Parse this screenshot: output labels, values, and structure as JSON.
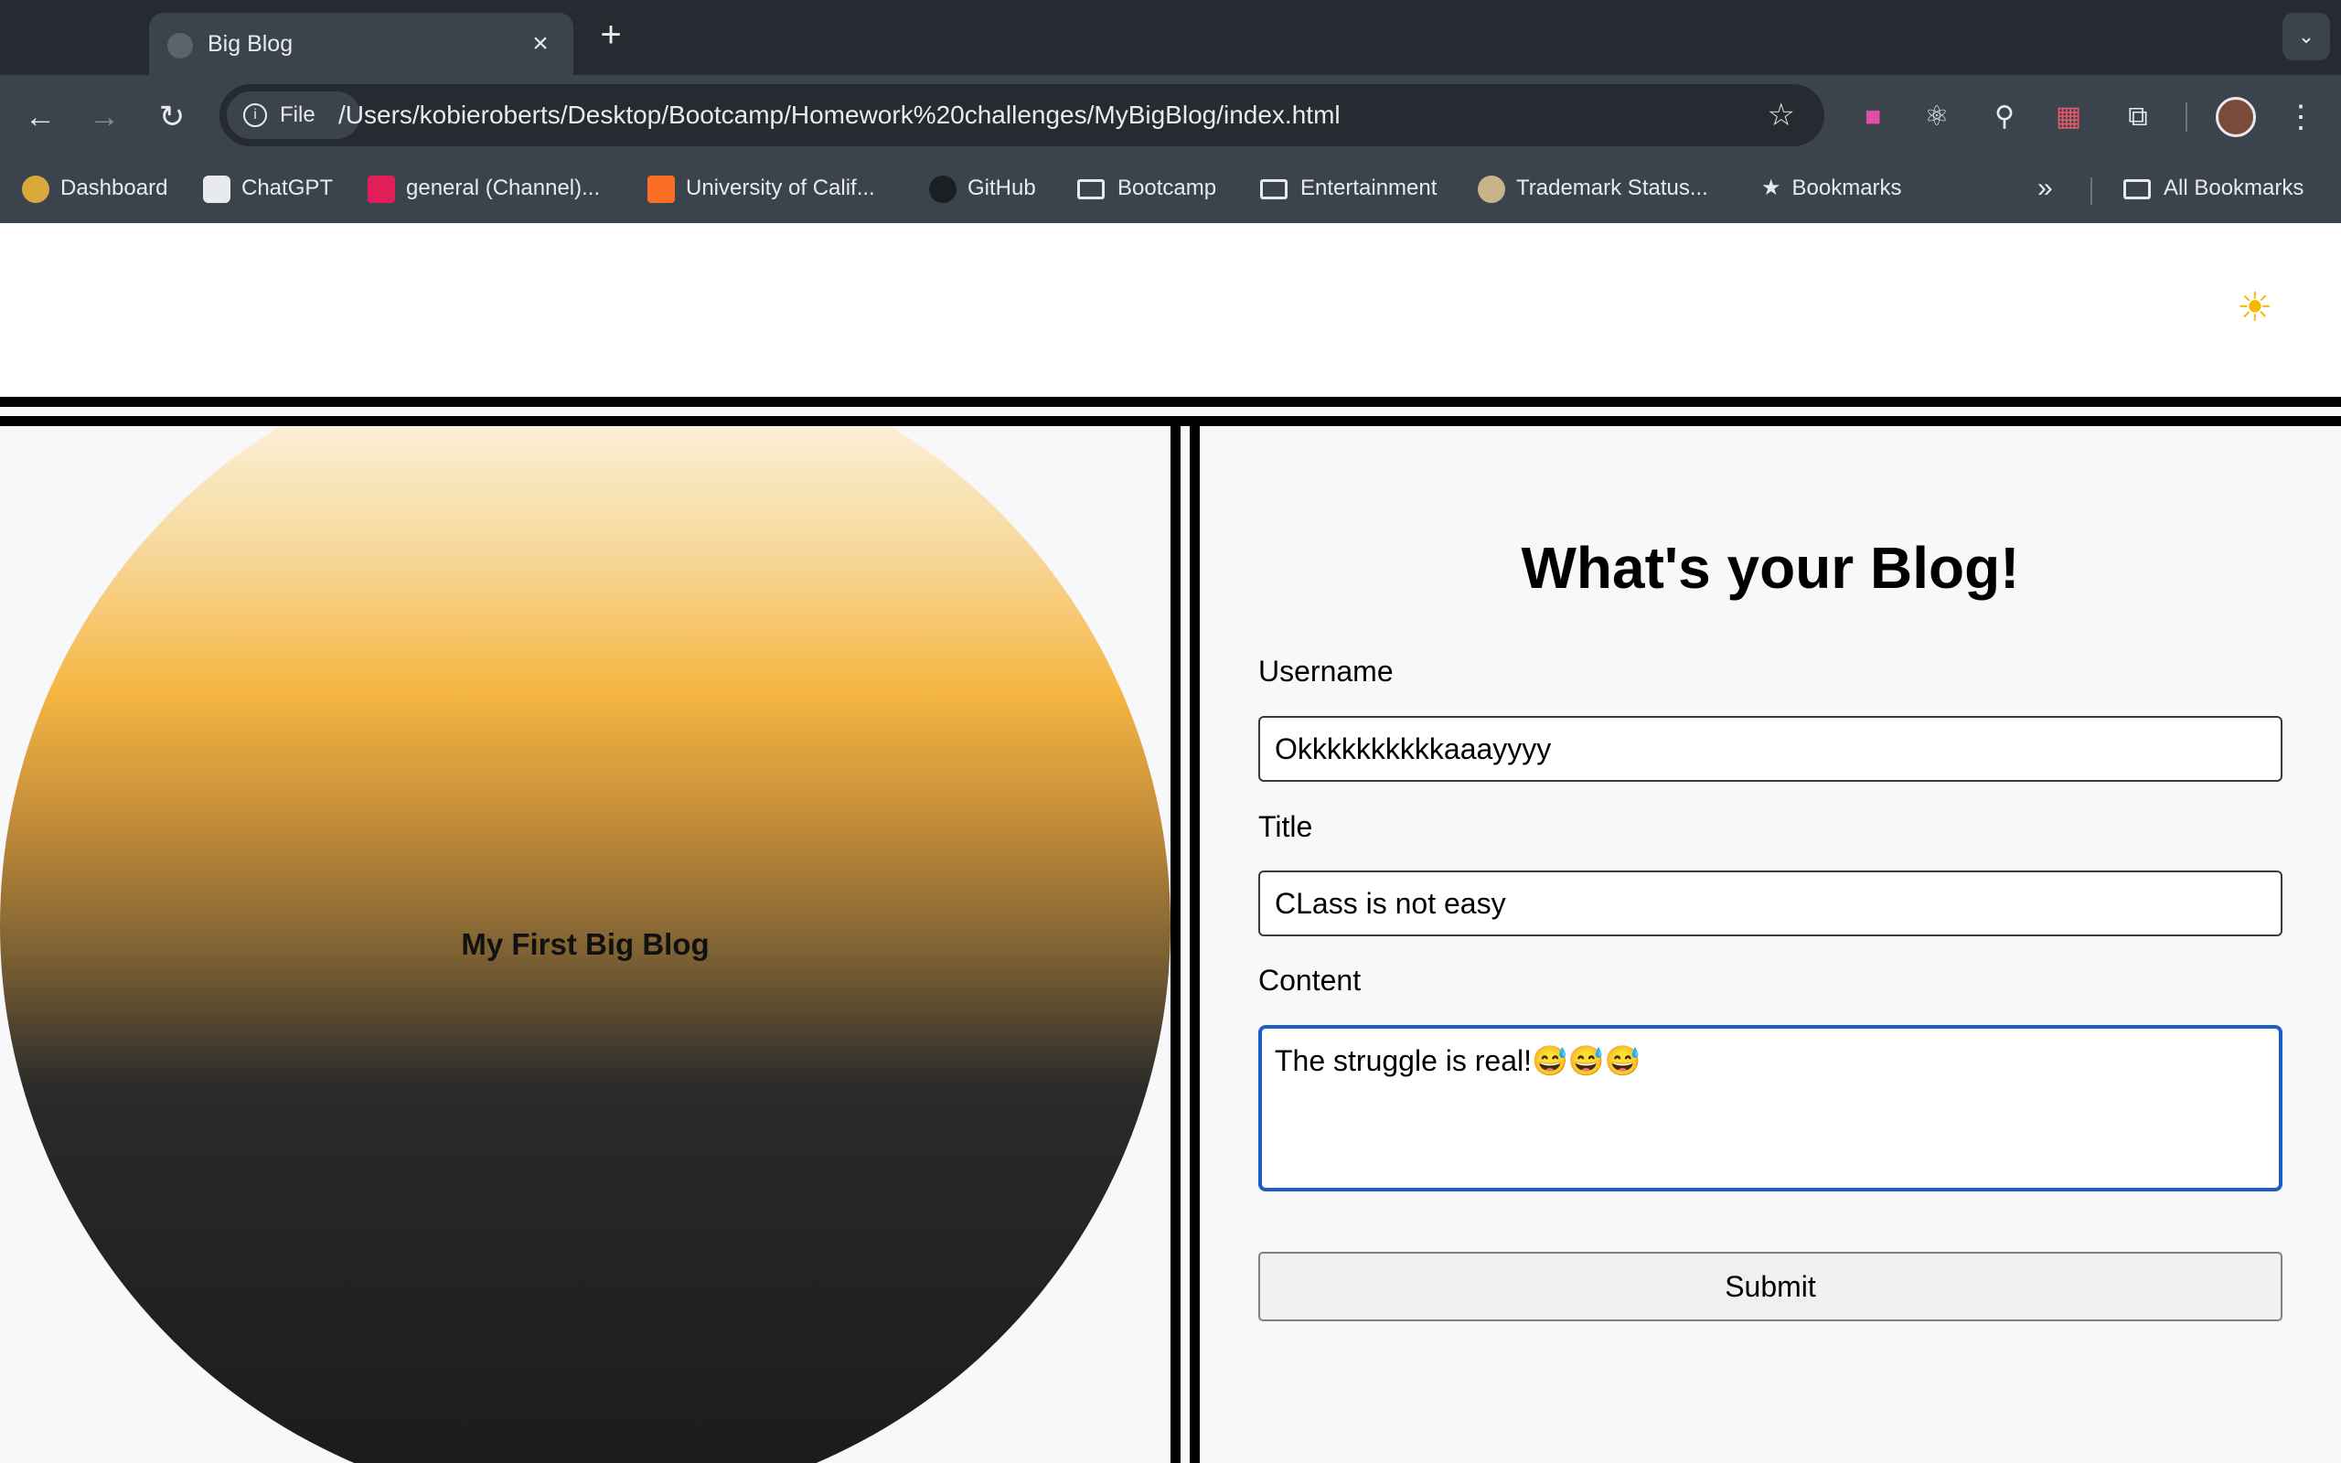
{
  "browser": {
    "tab_title": "Big Blog",
    "url_scheme_label": "File",
    "url": "/Users/kobieroberts/Desktop/Bootcamp/Homework%20challenges/MyBigBlog/index.html",
    "bookmarks": [
      {
        "label": "Dashboard",
        "icon": "dashboard-favicon"
      },
      {
        "label": "ChatGPT",
        "icon": "chatgpt-favicon"
      },
      {
        "label": "general (Channel)...",
        "icon": "slack-favicon"
      },
      {
        "label": "University of Calif...",
        "icon": "gitlab-favicon"
      },
      {
        "label": "GitHub",
        "icon": "github-favicon"
      },
      {
        "label": "Bootcamp",
        "icon": "folder-icon"
      },
      {
        "label": "Entertainment",
        "icon": "folder-icon"
      },
      {
        "label": "Trademark Status...",
        "icon": "trademark-favicon"
      },
      {
        "label": "Bookmarks",
        "icon": "star-icon"
      }
    ],
    "all_bookmarks_label": "All Bookmarks"
  },
  "page": {
    "theme_toggle_icon": "sun-icon",
    "hero_title": "My First Big Blog",
    "form": {
      "title": "What's your Blog!",
      "username_label": "Username",
      "username_value": "Okkkkkkkkkkaaayyyy",
      "title_label": "Title",
      "title_value": "CLass is not easy",
      "content_label": "Content",
      "content_value": "The struggle is real!😅😅😅",
      "submit_label": "Submit"
    }
  },
  "colors": {
    "accent_focus": "#1a5fc8",
    "orb_gold": "#f5b642"
  }
}
